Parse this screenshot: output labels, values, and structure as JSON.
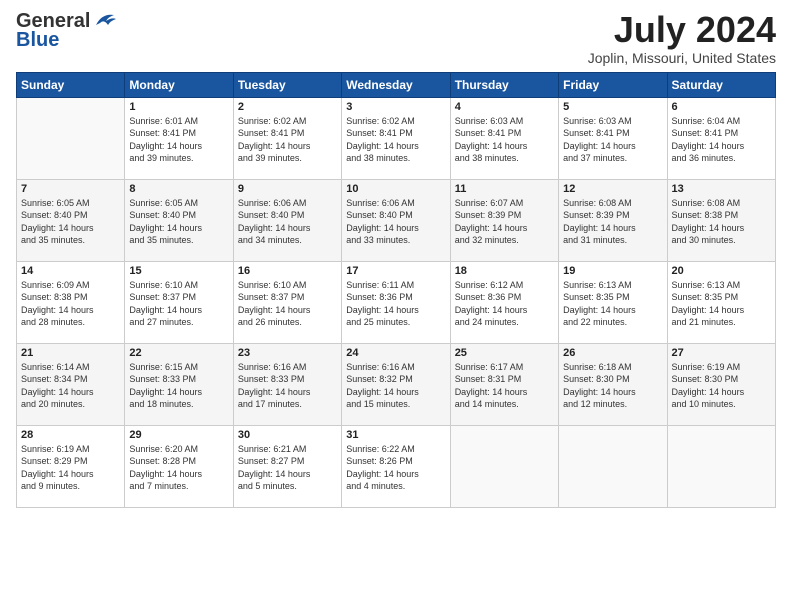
{
  "header": {
    "logo_general": "General",
    "logo_blue": "Blue",
    "title": "July 2024",
    "location": "Joplin, Missouri, United States"
  },
  "days_of_week": [
    "Sunday",
    "Monday",
    "Tuesday",
    "Wednesday",
    "Thursday",
    "Friday",
    "Saturday"
  ],
  "weeks": [
    [
      {
        "day": "",
        "text": ""
      },
      {
        "day": "1",
        "text": "Sunrise: 6:01 AM\nSunset: 8:41 PM\nDaylight: 14 hours\nand 39 minutes."
      },
      {
        "day": "2",
        "text": "Sunrise: 6:02 AM\nSunset: 8:41 PM\nDaylight: 14 hours\nand 39 minutes."
      },
      {
        "day": "3",
        "text": "Sunrise: 6:02 AM\nSunset: 8:41 PM\nDaylight: 14 hours\nand 38 minutes."
      },
      {
        "day": "4",
        "text": "Sunrise: 6:03 AM\nSunset: 8:41 PM\nDaylight: 14 hours\nand 38 minutes."
      },
      {
        "day": "5",
        "text": "Sunrise: 6:03 AM\nSunset: 8:41 PM\nDaylight: 14 hours\nand 37 minutes."
      },
      {
        "day": "6",
        "text": "Sunrise: 6:04 AM\nSunset: 8:41 PM\nDaylight: 14 hours\nand 36 minutes."
      }
    ],
    [
      {
        "day": "7",
        "text": "Sunrise: 6:05 AM\nSunset: 8:40 PM\nDaylight: 14 hours\nand 35 minutes."
      },
      {
        "day": "8",
        "text": "Sunrise: 6:05 AM\nSunset: 8:40 PM\nDaylight: 14 hours\nand 35 minutes."
      },
      {
        "day": "9",
        "text": "Sunrise: 6:06 AM\nSunset: 8:40 PM\nDaylight: 14 hours\nand 34 minutes."
      },
      {
        "day": "10",
        "text": "Sunrise: 6:06 AM\nSunset: 8:40 PM\nDaylight: 14 hours\nand 33 minutes."
      },
      {
        "day": "11",
        "text": "Sunrise: 6:07 AM\nSunset: 8:39 PM\nDaylight: 14 hours\nand 32 minutes."
      },
      {
        "day": "12",
        "text": "Sunrise: 6:08 AM\nSunset: 8:39 PM\nDaylight: 14 hours\nand 31 minutes."
      },
      {
        "day": "13",
        "text": "Sunrise: 6:08 AM\nSunset: 8:38 PM\nDaylight: 14 hours\nand 30 minutes."
      }
    ],
    [
      {
        "day": "14",
        "text": "Sunrise: 6:09 AM\nSunset: 8:38 PM\nDaylight: 14 hours\nand 28 minutes."
      },
      {
        "day": "15",
        "text": "Sunrise: 6:10 AM\nSunset: 8:37 PM\nDaylight: 14 hours\nand 27 minutes."
      },
      {
        "day": "16",
        "text": "Sunrise: 6:10 AM\nSunset: 8:37 PM\nDaylight: 14 hours\nand 26 minutes."
      },
      {
        "day": "17",
        "text": "Sunrise: 6:11 AM\nSunset: 8:36 PM\nDaylight: 14 hours\nand 25 minutes."
      },
      {
        "day": "18",
        "text": "Sunrise: 6:12 AM\nSunset: 8:36 PM\nDaylight: 14 hours\nand 24 minutes."
      },
      {
        "day": "19",
        "text": "Sunrise: 6:13 AM\nSunset: 8:35 PM\nDaylight: 14 hours\nand 22 minutes."
      },
      {
        "day": "20",
        "text": "Sunrise: 6:13 AM\nSunset: 8:35 PM\nDaylight: 14 hours\nand 21 minutes."
      }
    ],
    [
      {
        "day": "21",
        "text": "Sunrise: 6:14 AM\nSunset: 8:34 PM\nDaylight: 14 hours\nand 20 minutes."
      },
      {
        "day": "22",
        "text": "Sunrise: 6:15 AM\nSunset: 8:33 PM\nDaylight: 14 hours\nand 18 minutes."
      },
      {
        "day": "23",
        "text": "Sunrise: 6:16 AM\nSunset: 8:33 PM\nDaylight: 14 hours\nand 17 minutes."
      },
      {
        "day": "24",
        "text": "Sunrise: 6:16 AM\nSunset: 8:32 PM\nDaylight: 14 hours\nand 15 minutes."
      },
      {
        "day": "25",
        "text": "Sunrise: 6:17 AM\nSunset: 8:31 PM\nDaylight: 14 hours\nand 14 minutes."
      },
      {
        "day": "26",
        "text": "Sunrise: 6:18 AM\nSunset: 8:30 PM\nDaylight: 14 hours\nand 12 minutes."
      },
      {
        "day": "27",
        "text": "Sunrise: 6:19 AM\nSunset: 8:30 PM\nDaylight: 14 hours\nand 10 minutes."
      }
    ],
    [
      {
        "day": "28",
        "text": "Sunrise: 6:19 AM\nSunset: 8:29 PM\nDaylight: 14 hours\nand 9 minutes."
      },
      {
        "day": "29",
        "text": "Sunrise: 6:20 AM\nSunset: 8:28 PM\nDaylight: 14 hours\nand 7 minutes."
      },
      {
        "day": "30",
        "text": "Sunrise: 6:21 AM\nSunset: 8:27 PM\nDaylight: 14 hours\nand 5 minutes."
      },
      {
        "day": "31",
        "text": "Sunrise: 6:22 AM\nSunset: 8:26 PM\nDaylight: 14 hours\nand 4 minutes."
      },
      {
        "day": "",
        "text": ""
      },
      {
        "day": "",
        "text": ""
      },
      {
        "day": "",
        "text": ""
      }
    ]
  ]
}
